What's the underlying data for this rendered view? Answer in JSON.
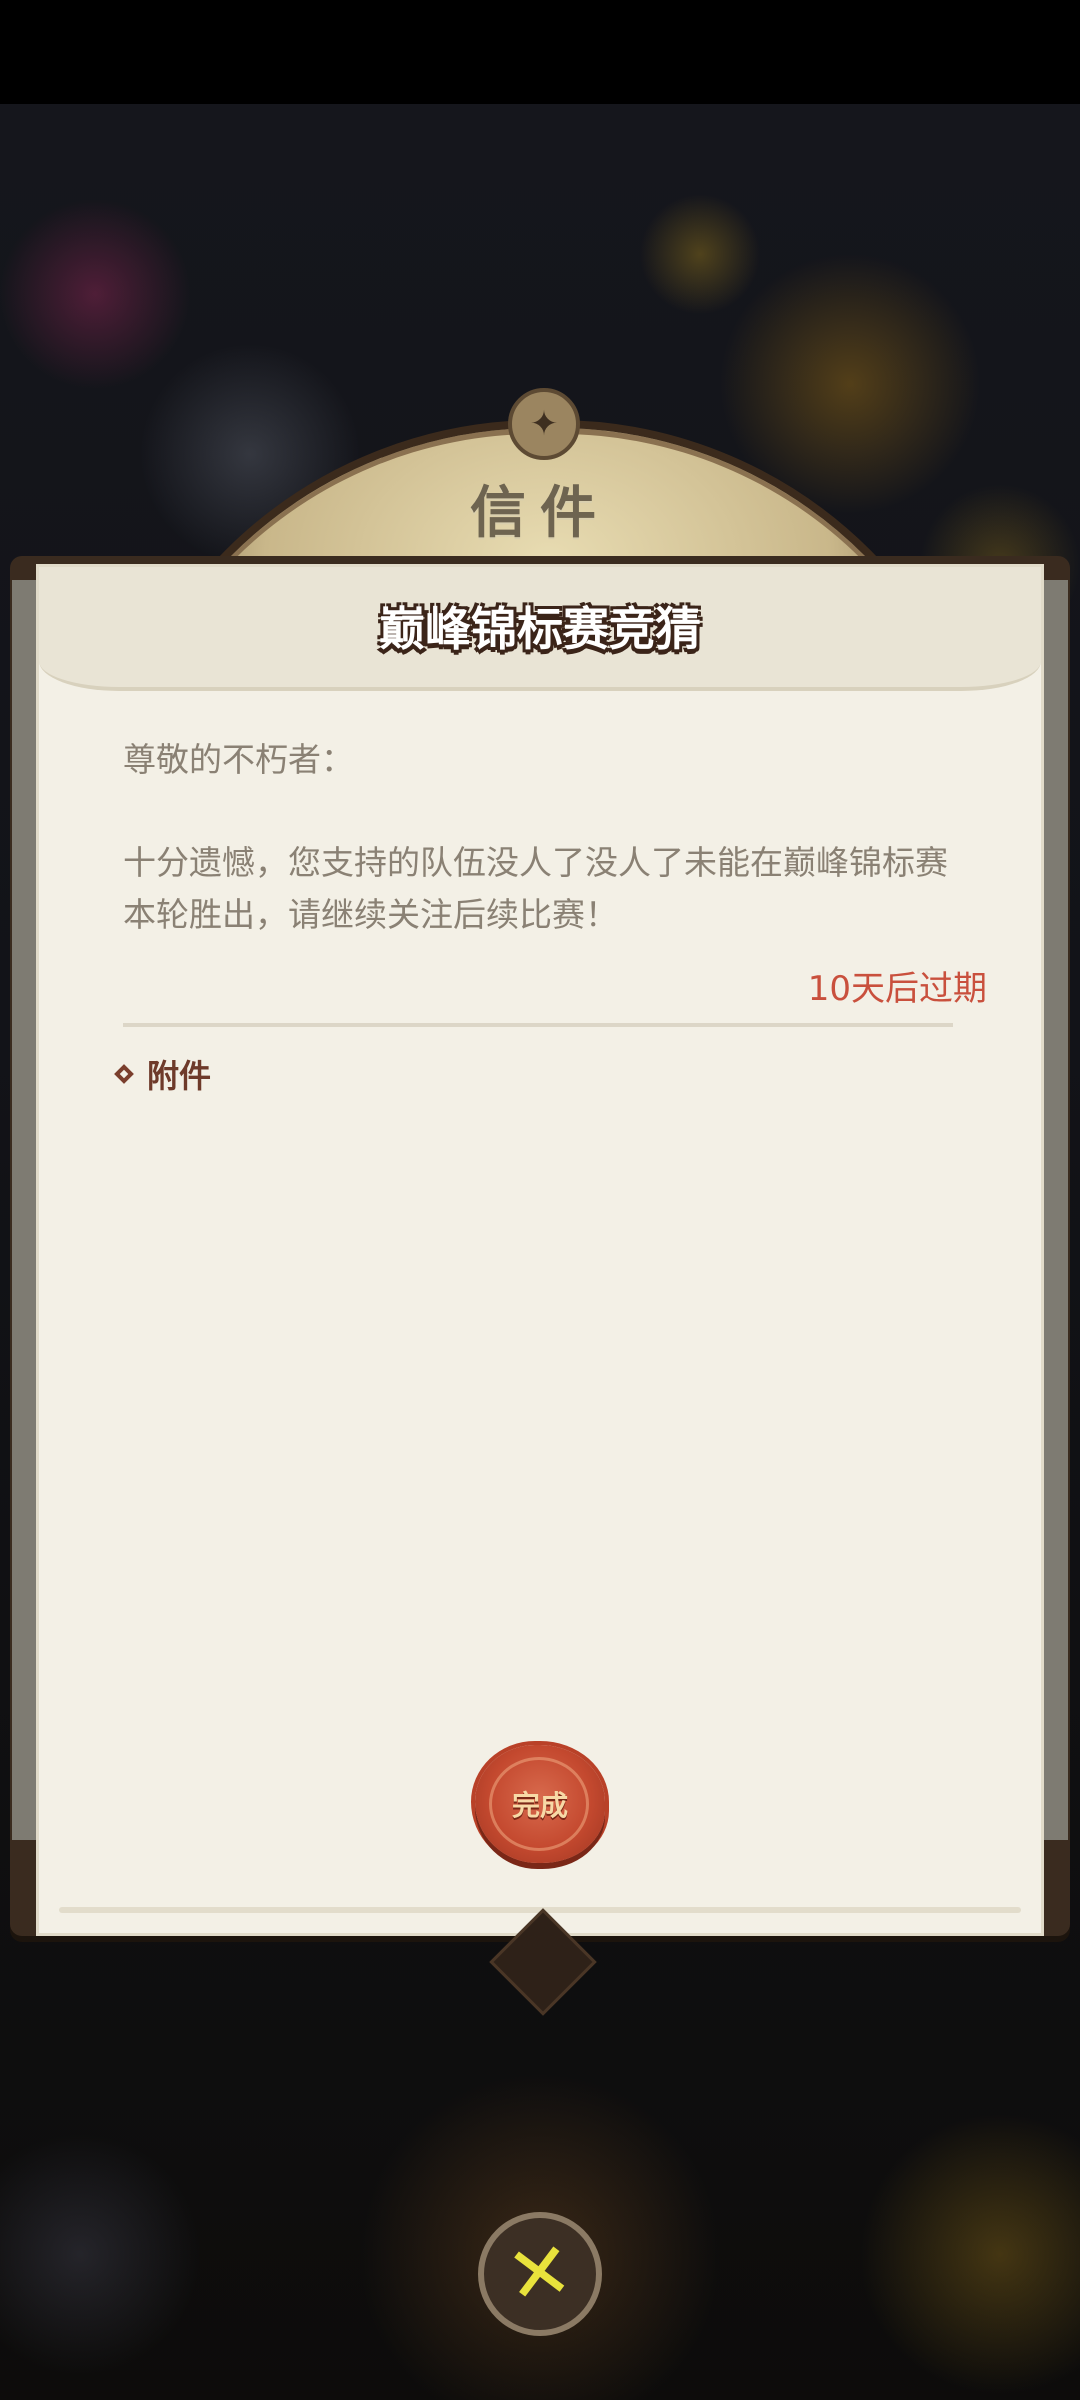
{
  "header": {
    "section_title": "信件"
  },
  "mail": {
    "title": "巅峰锦标赛竞猜",
    "greeting": "尊敬的不朽者：",
    "body": "十分遗憾，您支持的队伍没人了没人了未能在巅峰锦标赛本轮胜出，请继续关注后续比赛！",
    "expiry": "10天后过期",
    "attachment_label": "附件"
  },
  "actions": {
    "complete_label": "完成",
    "close_icon": "close-icon"
  },
  "colors": {
    "expiry_red": "#c9503d",
    "seal_red": "#c4492f",
    "paper": "#f3f0e6",
    "close_yellow": "#e8e23c"
  }
}
